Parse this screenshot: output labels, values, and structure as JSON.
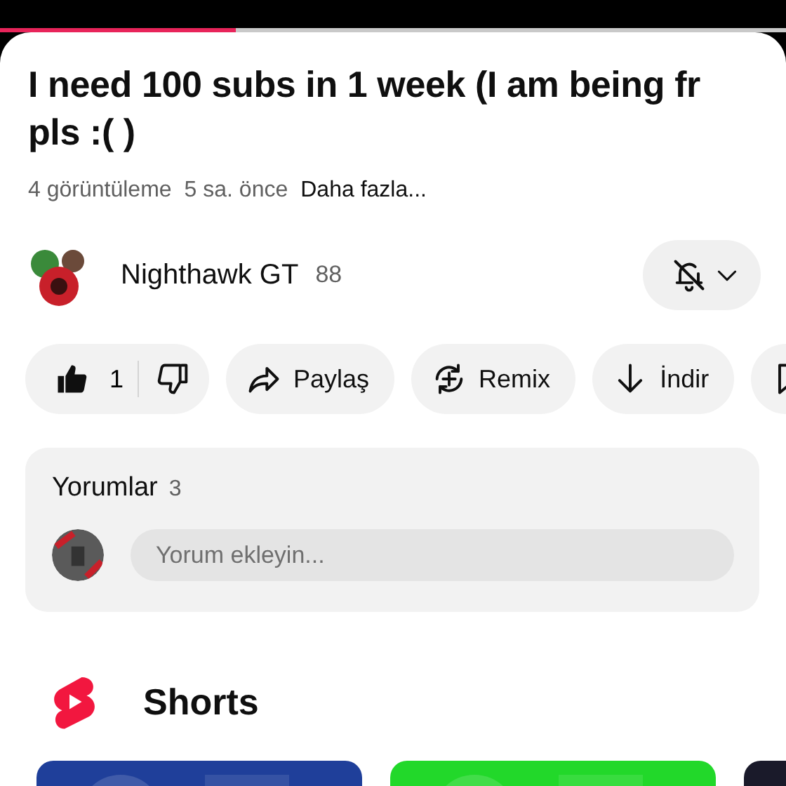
{
  "player": {
    "progress": {
      "level": 0.3
    }
  },
  "video": {
    "title": "I need 100 subs in 1 week (I am being fr pls :( )",
    "views": "4 görüntüleme",
    "age": "5 sa. önce",
    "more": "Daha fazla..."
  },
  "channel": {
    "name": "Nighthawk GT",
    "subscribers": "88"
  },
  "actions": [
    {
      "kind": "like",
      "label": "1"
    },
    {
      "kind": "share",
      "label": "Paylaş"
    },
    {
      "kind": "remix",
      "label": "Remix"
    },
    {
      "kind": "download",
      "label": "İndir"
    },
    {
      "kind": "save"
    }
  ],
  "comments": {
    "title": "Yorumlar",
    "count": "3",
    "placeholder": "Yorum ekleyin..."
  },
  "shorts": {
    "title": "Shorts"
  }
}
